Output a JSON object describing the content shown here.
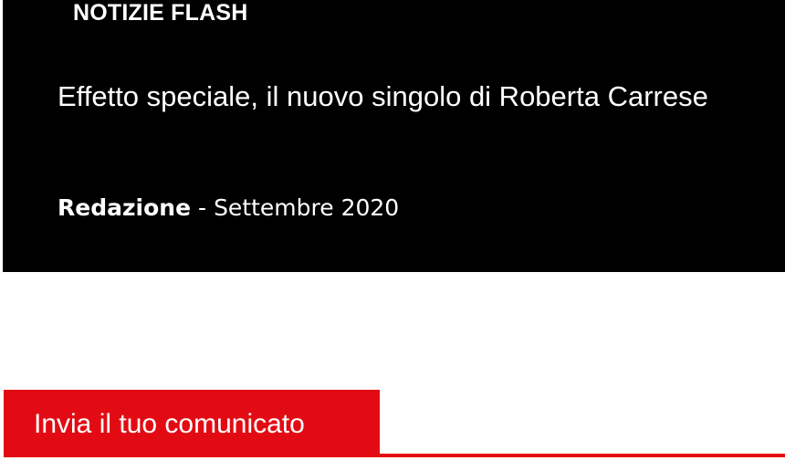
{
  "flash": {
    "label": "NOTIZIE FLASH",
    "article": {
      "title": "Effetto speciale, il nuovo singolo di Roberta Carrese",
      "author": "Redazione",
      "separator": "-",
      "date": "Settembre 2020"
    }
  },
  "section": {
    "tab_label": "Invia il tuo comunicato",
    "accent_color": "#e30b13"
  }
}
